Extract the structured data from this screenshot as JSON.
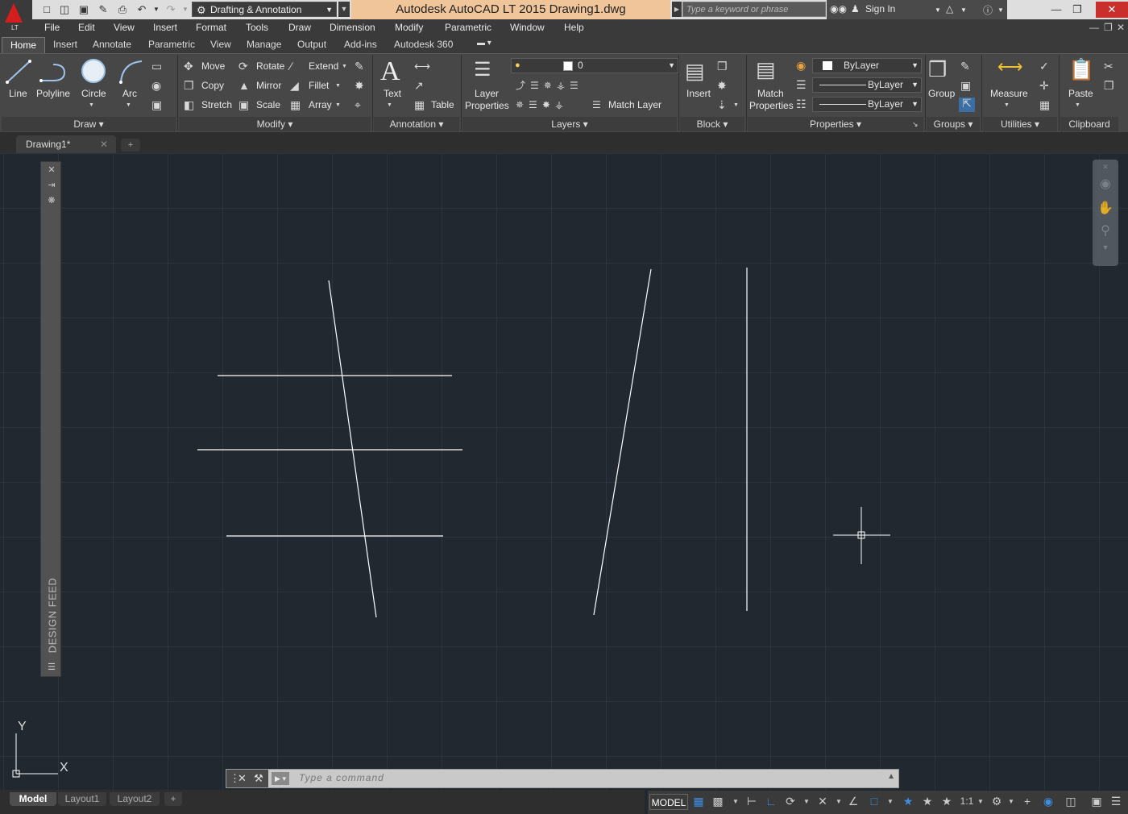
{
  "app": {
    "logo_text": "LT",
    "title": "Autodesk AutoCAD LT 2015    Drawing1.dwg",
    "workspace": "Drafting & Annotation",
    "search_placeholder": "Type a keyword or phrase",
    "sign_in": "Sign In"
  },
  "menu": [
    "File",
    "Edit",
    "View",
    "Insert",
    "Format",
    "Tools",
    "Draw",
    "Dimension",
    "Modify",
    "Parametric",
    "Window",
    "Help"
  ],
  "ribbon_tabs": [
    "Home",
    "Insert",
    "Annotate",
    "Parametric",
    "View",
    "Manage",
    "Output",
    "Add-ins",
    "Autodesk 360"
  ],
  "ribbon": {
    "draw": {
      "title": "Draw",
      "line": "Line",
      "polyline": "Polyline",
      "circle": "Circle",
      "arc": "Arc"
    },
    "modify": {
      "title": "Modify",
      "move": "Move",
      "rotate": "Rotate",
      "extend": "Extend",
      "copy": "Copy",
      "mirror": "Mirror",
      "fillet": "Fillet",
      "stretch": "Stretch",
      "scale": "Scale",
      "array": "Array"
    },
    "annotation": {
      "title": "Annotation",
      "text": "Text",
      "table": "Table"
    },
    "layers": {
      "title": "Layers",
      "layer_properties_1": "Layer",
      "layer_properties_2": "Properties",
      "current_layer": "0",
      "match_layer": "Match Layer"
    },
    "block": {
      "title": "Block",
      "insert": "Insert"
    },
    "properties": {
      "title": "Properties",
      "match_1": "Match",
      "match_2": "Properties",
      "color": "ByLayer",
      "linetype": "ByLayer",
      "lineweight": "ByLayer"
    },
    "groups": {
      "title": "Groups",
      "group": "Group"
    },
    "utilities": {
      "title": "Utilities",
      "measure": "Measure"
    },
    "clipboard": {
      "title": "Clipboard",
      "paste": "Paste"
    }
  },
  "file_tabs": [
    {
      "label": "Drawing1*"
    }
  ],
  "design_feed": {
    "label": "DESIGN FEED"
  },
  "ucs": {
    "x": "X",
    "y": "Y"
  },
  "command_line": {
    "placeholder": "Type  a  command"
  },
  "layout_tabs": [
    "Model",
    "Layout1",
    "Layout2"
  ],
  "status": {
    "model": "MODEL",
    "scale": "1:1"
  },
  "icons": [
    "line-icon",
    "polyline-icon",
    "circle-icon",
    "arc-icon",
    "move-icon",
    "rotate-icon",
    "extend-icon",
    "copy-icon",
    "mirror-icon",
    "fillet-icon",
    "stretch-icon",
    "scale-icon",
    "array-icon",
    "text-icon",
    "table-icon",
    "layer-icon",
    "insert-block-icon",
    "match-properties-icon",
    "group-icon",
    "measure-icon",
    "paste-icon",
    "gear-icon",
    "search-icon",
    "help-icon",
    "pan-icon",
    "zoom-icon"
  ]
}
